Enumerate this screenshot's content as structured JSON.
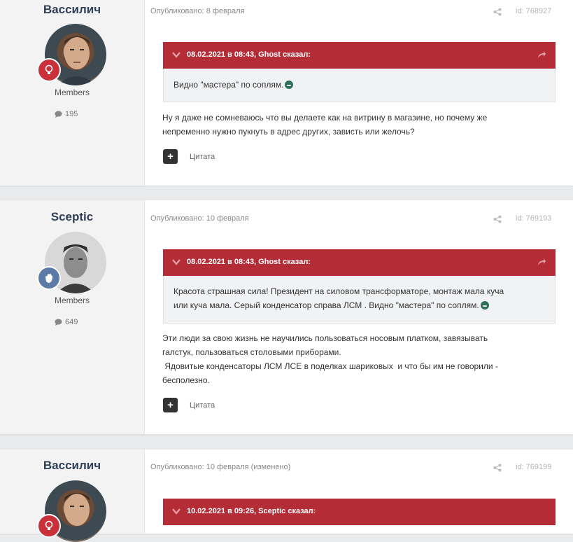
{
  "posts": [
    {
      "author": "Вассилич",
      "group": "Members",
      "post_count": "195",
      "published": "Опубликовано: 8 февраля",
      "post_id": "id: 768927",
      "quote_header": "08.02.2021 в 08:43, Ghost сказал:",
      "quote_text": "Видно \"мастера\" по соплям.",
      "body_lines": [
        "Ну я даже не сомневаюсь что вы делаете как на витрину в магазине, но почему же",
        "непременно нужно пукнуть в адрес других, зависть или желочь?"
      ],
      "quote_button": "Цитата"
    },
    {
      "author": "Sceptic",
      "group": "Members",
      "post_count": "649",
      "published": "Опубликовано: 10 февраля",
      "post_id": "id: 769193",
      "quote_header": "08.02.2021 в 08:43, Ghost сказал:",
      "quote_lines": [
        "Красота страшная сила! Президент на силовом  трансформаторе,  монтаж мала куча",
        "или куча мала. Серый конденсатор справа ЛСМ . Видно \"мастера\" по соплям."
      ],
      "body_lines": [
        "Эти люди за свою жизнь не научились пользоваться носовым платком, завязывать",
        "галстук, пользоваться столовыми приборами.",
        " Ядовитые конденсаторы ЛСМ ЛСЕ в поделках шариковых  и что бы им не говорили -",
        "бесполезно."
      ],
      "quote_button": "Цитата"
    },
    {
      "author": "Вассилич",
      "published": "Опубликовано: 10 февраля (изменено)",
      "post_id": "id: 769199",
      "quote_header": "10.02.2021 в 09:26, Sceptic сказал:"
    }
  ],
  "colors": {
    "quote_header_bg": "#b42d36",
    "badge_red": "#c9303a",
    "badge_blue": "#5b7aa6",
    "author_name": "#2f3f55"
  },
  "icons": {
    "chevron": "chevron-down-icon",
    "forward": "forward-arrow-icon",
    "share": "share-icon",
    "comment": "comment-icon",
    "plus": "plus-icon",
    "bulb": "lightbulb-icon",
    "hand": "hand-wave-icon"
  }
}
